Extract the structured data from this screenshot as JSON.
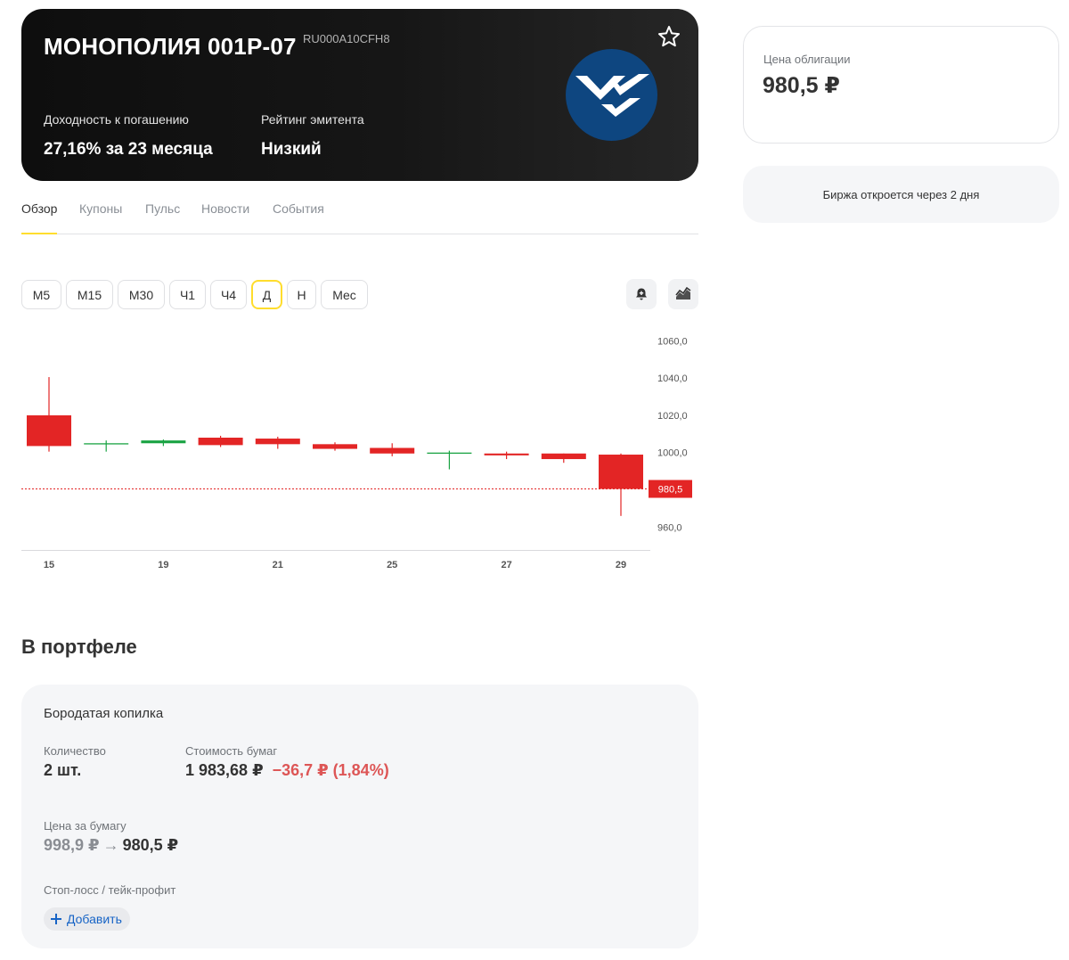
{
  "hero": {
    "title": "МОНОПОЛИЯ 001P-07",
    "isin": "RU000A10CFH8",
    "yield_label": "Доходность к погашению",
    "yield_value": "27,16% за 23 месяца",
    "rating_label": "Рейтинг эмитента",
    "rating_value": "Низкий",
    "icons": [
      "star-icon",
      "issuer-logo"
    ]
  },
  "tabs": [
    {
      "label": "Обзор",
      "active": true
    },
    {
      "label": "Купоны"
    },
    {
      "label": "Пульс"
    },
    {
      "label": "Новости"
    },
    {
      "label": "События"
    }
  ],
  "periods": [
    {
      "label": "M5"
    },
    {
      "label": "M15"
    },
    {
      "label": "M30"
    },
    {
      "label": "Ч1"
    },
    {
      "label": "Ч4"
    },
    {
      "label": "Д",
      "active": true
    },
    {
      "label": "Н"
    },
    {
      "label": "Мес"
    }
  ],
  "toolbar": {
    "alert_icon": "bell-plus-icon",
    "chart_type_icon": "area-chart-icon"
  },
  "chart_data": {
    "type": "candlestick",
    "x_ticks": [
      "15",
      "19",
      "21",
      "25",
      "27",
      "29"
    ],
    "y_ticks": [
      "1060,0",
      "1040,0",
      "1020,0",
      "1000,0",
      "960,0"
    ],
    "ylim": [
      953,
      1063
    ],
    "current_price": 980.5,
    "current_price_label": "980,5",
    "colors": {
      "up": "#1aa343",
      "down": "#e32525",
      "price_line": "#e32525"
    },
    "candles": [
      {
        "open": 1020.0,
        "high": 1040.5,
        "low": 1000.5,
        "close": 1003.5
      },
      {
        "open": 1004.5,
        "high": 1006.5,
        "low": 1000.5,
        "close": 1005.0
      },
      {
        "open": 1005.0,
        "high": 1007.0,
        "low": 1003.5,
        "close": 1006.5
      },
      {
        "open": 1008.0,
        "high": 1009.0,
        "low": 1003.0,
        "close": 1004.0
      },
      {
        "open": 1007.5,
        "high": 1008.5,
        "low": 1002.0,
        "close": 1004.5
      },
      {
        "open": 1004.5,
        "high": 1005.5,
        "low": 1001.0,
        "close": 1002.0
      },
      {
        "open": 1002.5,
        "high": 1005.0,
        "low": 998.0,
        "close": 999.5
      },
      {
        "open": 999.5,
        "high": 1001.0,
        "low": 991.0,
        "close": 1000.0
      },
      {
        "open": 999.5,
        "high": 1000.5,
        "low": 996.5,
        "close": 998.5
      },
      {
        "open": 999.5,
        "high": 999.5,
        "low": 994.5,
        "close": 996.5
      },
      {
        "open": 998.9,
        "high": 999.5,
        "low": 966.0,
        "close": 980.5
      }
    ]
  },
  "portfolio": {
    "title": "В портфеле",
    "account_name": "Бородатая копилка",
    "quantity_label": "Количество",
    "quantity_value": "2 шт.",
    "cost_label": "Стоимость бумаг",
    "cost_value": "1 983,68 ₽",
    "cost_change": "−36,7 ₽ (1,84%)",
    "price_label": "Цена за бумагу",
    "price_old": "998,9 ₽",
    "price_arrow": "→",
    "price_new": "980,5 ₽",
    "stop_label": "Стоп-лосс / тейк-профит",
    "add_label": "Добавить",
    "change_color": "#dd5656"
  },
  "sidebar": {
    "price_label": "Цена облигации",
    "price_value": "980,5 ₽",
    "status_text": "Биржа откроется через 2 дня"
  }
}
